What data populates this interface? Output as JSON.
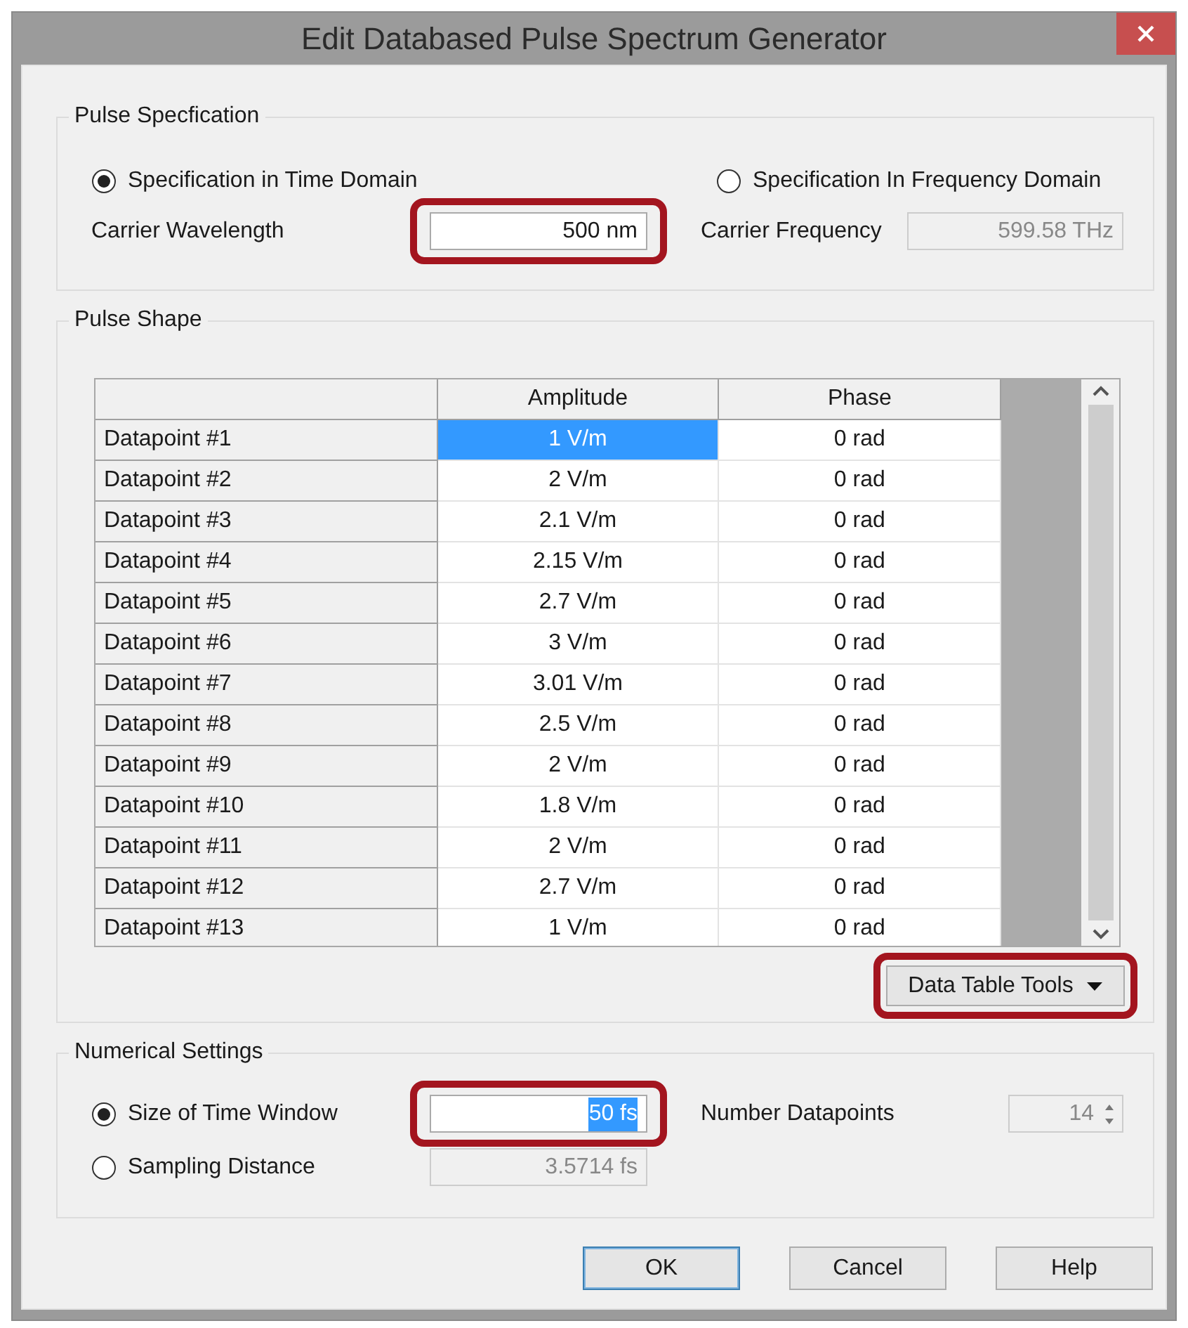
{
  "window": {
    "title": "Edit Databased Pulse Spectrum Generator"
  },
  "pulse_specification": {
    "title": "Pulse Specfication",
    "options": [
      {
        "label": "Specification in Time Domain",
        "selected": true
      },
      {
        "label": "Specification In Frequency Domain",
        "selected": false
      }
    ],
    "carrier_wavelength": {
      "label": "Carrier Wavelength",
      "value": "500 nm",
      "highlighted": true
    },
    "carrier_frequency": {
      "label": "Carrier Frequency",
      "value": "599.58 THz",
      "disabled": true
    }
  },
  "pulse_shape": {
    "title": "Pulse Shape",
    "table": {
      "columns": [
        "Amplitude",
        "Phase"
      ],
      "rows": [
        {
          "label": "Datapoint #1",
          "amplitude": "1 V/m",
          "phase": "0 rad",
          "selected": true
        },
        {
          "label": "Datapoint #2",
          "amplitude": "2 V/m",
          "phase": "0 rad",
          "selected": false
        },
        {
          "label": "Datapoint #3",
          "amplitude": "2.1 V/m",
          "phase": "0 rad",
          "selected": false
        },
        {
          "label": "Datapoint #4",
          "amplitude": "2.15 V/m",
          "phase": "0 rad",
          "selected": false
        },
        {
          "label": "Datapoint #5",
          "amplitude": "2.7 V/m",
          "phase": "0 rad",
          "selected": false
        },
        {
          "label": "Datapoint #6",
          "amplitude": "3 V/m",
          "phase": "0 rad",
          "selected": false
        },
        {
          "label": "Datapoint #7",
          "amplitude": "3.01 V/m",
          "phase": "0 rad",
          "selected": false
        },
        {
          "label": "Datapoint #8",
          "amplitude": "2.5 V/m",
          "phase": "0 rad",
          "selected": false
        },
        {
          "label": "Datapoint #9",
          "amplitude": "2 V/m",
          "phase": "0 rad",
          "selected": false
        },
        {
          "label": "Datapoint #10",
          "amplitude": "1.8 V/m",
          "phase": "0 rad",
          "selected": false
        },
        {
          "label": "Datapoint #11",
          "amplitude": "2 V/m",
          "phase": "0 rad",
          "selected": false
        },
        {
          "label": "Datapoint #12",
          "amplitude": "2.7 V/m",
          "phase": "0 rad",
          "selected": false
        },
        {
          "label": "Datapoint #13",
          "amplitude": "1 V/m",
          "phase": "0 rad",
          "selected": false
        }
      ]
    },
    "tools_button": {
      "label": "Data Table Tools",
      "highlighted": true
    }
  },
  "numerical_settings": {
    "title": "Numerical Settings",
    "options": [
      {
        "label": "Size of Time Window",
        "selected": true,
        "value": "50 fs",
        "text_selected": true,
        "highlighted": true
      },
      {
        "label": "Sampling Distance",
        "selected": false,
        "value": "3.5714 fs",
        "text_selected": false
      }
    ],
    "datapoints": {
      "label": "Number Datapoints",
      "value": "14",
      "disabled": true
    }
  },
  "buttons": [
    {
      "label": "OK",
      "default": true
    },
    {
      "label": "Cancel",
      "default": false
    },
    {
      "label": "Help",
      "default": false
    }
  ]
}
